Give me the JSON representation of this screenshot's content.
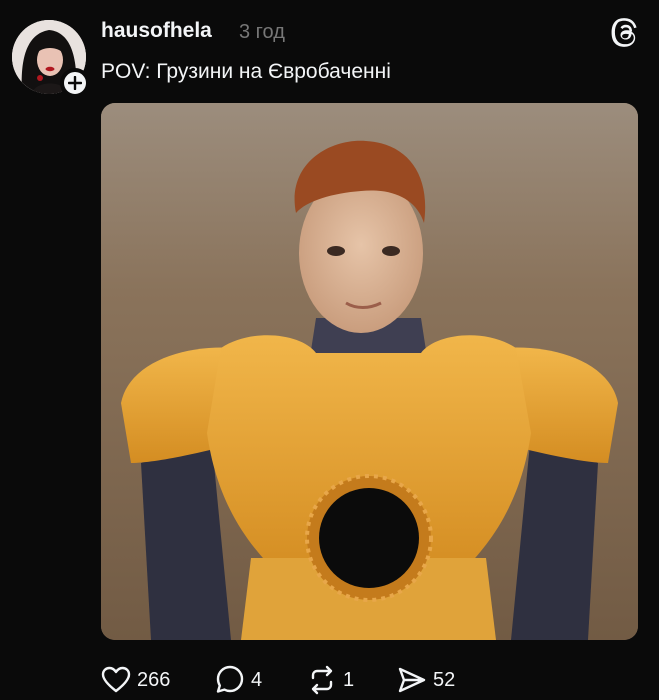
{
  "post": {
    "username": "hausofhela",
    "time": "3 год",
    "caption": "POV: Грузини на Євробаченні",
    "image_subject": "boy-in-yellow-armor-suit"
  },
  "actions": {
    "likes": "266",
    "replies": "4",
    "reposts": "1",
    "shares": "52"
  },
  "icons": {
    "like": "heart-icon",
    "reply": "speech-bubble-icon",
    "repost": "repost-icon",
    "share": "send-icon",
    "brand": "threads-logo-icon",
    "follow": "plus-icon"
  },
  "colors": {
    "background": "#0a0a0a",
    "text": "#f3f5f7",
    "muted": "#777777"
  }
}
